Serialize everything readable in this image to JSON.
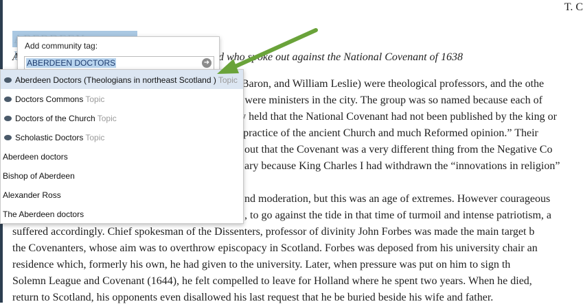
{
  "corner_text": "T. C",
  "heading": "ABERDEEN DOCTORS",
  "subtitle_left": "A",
  "subtitle_right": "d who spoke out against the National Covenant of 1638",
  "body_lines": [
    "bert Baron, and William Leslie) were theological professors, and the othe",
    ") were ministers in the city. The group was so named because each of",
    "ey held that the National Covenant had not been published by the king or",
    "e practice of the ancient Church and much Reformed opinion.” Their",
    "out that the Covenant was a very different thing from the Negative Co",
    "ary because King Charles I had withdrawn the “innovations in religion”",
    "nd moderation, but this was an age of extremes. However courageous",
    ", to go against the tide in that time of turmoil and intense patriotism, a",
    "suffered accordingly. Chief spokesman of the Dissenters, professor of divinity John Forbes was made the main target b",
    "the Covenanters, whose aim was to overthrow episcopacy in Scotland. Forbes was deposed from his university chair an",
    "residence which, formerly his own, he had given to the university. Later, when pressure was put on him to sign th",
    "Solemn League and Covenant (1644), he felt compelled to leave for Holland where he spent two years. When he died,",
    "return to Scotland, his opponents even disallowed his last request that he be buried beside his wife and father."
  ],
  "popup": {
    "label": "Add community tag:",
    "input_value": "ABERDEEN DOCTORS",
    "go_icon": "arrow-right-icon"
  },
  "suggestions": [
    {
      "label": "Aberdeen Doctors (Theologians in northeast Scotland )",
      "type": "Topic",
      "topic": true
    },
    {
      "label": "Doctors Commons",
      "type": "Topic",
      "topic": true
    },
    {
      "label": "Doctors of the Church",
      "type": "Topic",
      "topic": true
    },
    {
      "label": "Scholastic Doctors",
      "type": "Topic",
      "topic": true
    },
    {
      "label": "Aberdeen doctors",
      "type": "",
      "topic": false
    },
    {
      "label": "Bishop of Aberdeen",
      "type": "",
      "topic": false
    },
    {
      "label": "Alexander Ross",
      "type": "",
      "topic": false
    },
    {
      "label": "The Aberdeen doctors",
      "type": "",
      "topic": false
    }
  ],
  "colors": {
    "arrow": "#6aa33a",
    "highlight": "#aac8e2",
    "dark_bar": "#2c3e50"
  }
}
